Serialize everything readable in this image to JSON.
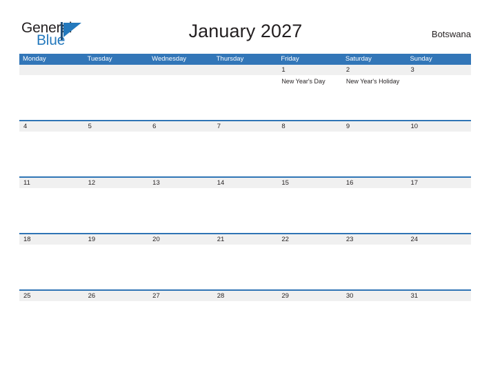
{
  "branding": {
    "name_part1": "General",
    "name_part2": "Blue",
    "flag_icon": "flag-triangle-icon",
    "color_dark": "#231F20",
    "color_blue": "#2479BD"
  },
  "header": {
    "title": "January 2027",
    "country": "Botswana"
  },
  "theme": {
    "header_blue": "#3276B8",
    "row_divider_blue": "#2E74B5",
    "date_band_gray": "#F0F0F0",
    "page_background": "#FFFFFF"
  },
  "calendar": {
    "month": "January",
    "year": "2027",
    "weekday_headers": [
      "Monday",
      "Tuesday",
      "Wednesday",
      "Thursday",
      "Friday",
      "Saturday",
      "Sunday"
    ],
    "weeks": [
      {
        "days": [
          {
            "date": "",
            "events": []
          },
          {
            "date": "",
            "events": []
          },
          {
            "date": "",
            "events": []
          },
          {
            "date": "",
            "events": []
          },
          {
            "date": "1",
            "events": [
              "New Year's Day"
            ]
          },
          {
            "date": "2",
            "events": [
              "New Year's Holiday"
            ]
          },
          {
            "date": "3",
            "events": []
          }
        ]
      },
      {
        "days": [
          {
            "date": "4",
            "events": []
          },
          {
            "date": "5",
            "events": []
          },
          {
            "date": "6",
            "events": []
          },
          {
            "date": "7",
            "events": []
          },
          {
            "date": "8",
            "events": []
          },
          {
            "date": "9",
            "events": []
          },
          {
            "date": "10",
            "events": []
          }
        ]
      },
      {
        "days": [
          {
            "date": "11",
            "events": []
          },
          {
            "date": "12",
            "events": []
          },
          {
            "date": "13",
            "events": []
          },
          {
            "date": "14",
            "events": []
          },
          {
            "date": "15",
            "events": []
          },
          {
            "date": "16",
            "events": []
          },
          {
            "date": "17",
            "events": []
          }
        ]
      },
      {
        "days": [
          {
            "date": "18",
            "events": []
          },
          {
            "date": "19",
            "events": []
          },
          {
            "date": "20",
            "events": []
          },
          {
            "date": "21",
            "events": []
          },
          {
            "date": "22",
            "events": []
          },
          {
            "date": "23",
            "events": []
          },
          {
            "date": "24",
            "events": []
          }
        ]
      },
      {
        "days": [
          {
            "date": "25",
            "events": []
          },
          {
            "date": "26",
            "events": []
          },
          {
            "date": "27",
            "events": []
          },
          {
            "date": "28",
            "events": []
          },
          {
            "date": "29",
            "events": []
          },
          {
            "date": "30",
            "events": []
          },
          {
            "date": "31",
            "events": []
          }
        ]
      }
    ]
  }
}
